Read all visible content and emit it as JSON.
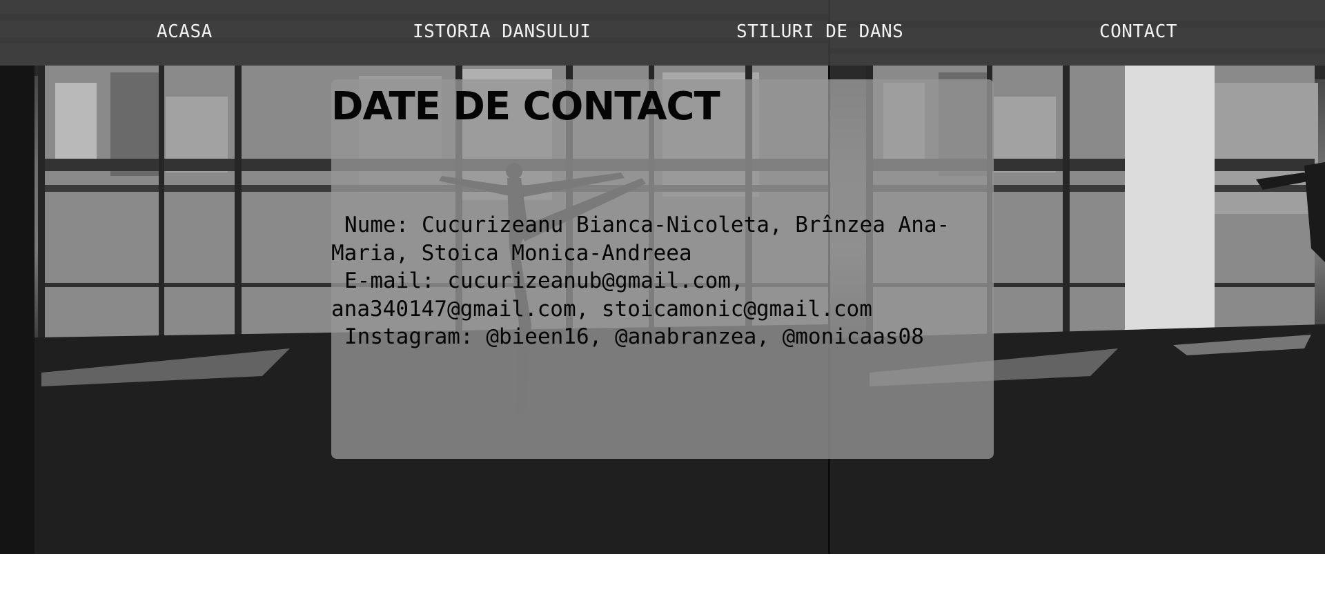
{
  "nav": {
    "items": [
      {
        "label": "ACASA"
      },
      {
        "label": "ISTORIA DANSULUI"
      },
      {
        "label": "STILURI DE DANS"
      },
      {
        "label": "CONTACT"
      }
    ]
  },
  "contact": {
    "title": "DATE DE CONTACT",
    "lines": [
      {
        "label": "Nume:",
        "value": "Cucurizeanu Bianca-Nicoleta, Brînzea Ana-Maria, Stoica Monica-Andreea"
      },
      {
        "label": "E-mail:",
        "value": "cucurizeanub@gmail.com, ana340147@gmail.com, stoicamonic@gmail.com"
      },
      {
        "label": "Instagram:",
        "value": "@bieen16, @anabranzea, @monicaas08"
      }
    ]
  },
  "colors": {
    "nav_text": "#f2f2f2",
    "card_text": "#050505",
    "page_background": "#ffffff"
  }
}
